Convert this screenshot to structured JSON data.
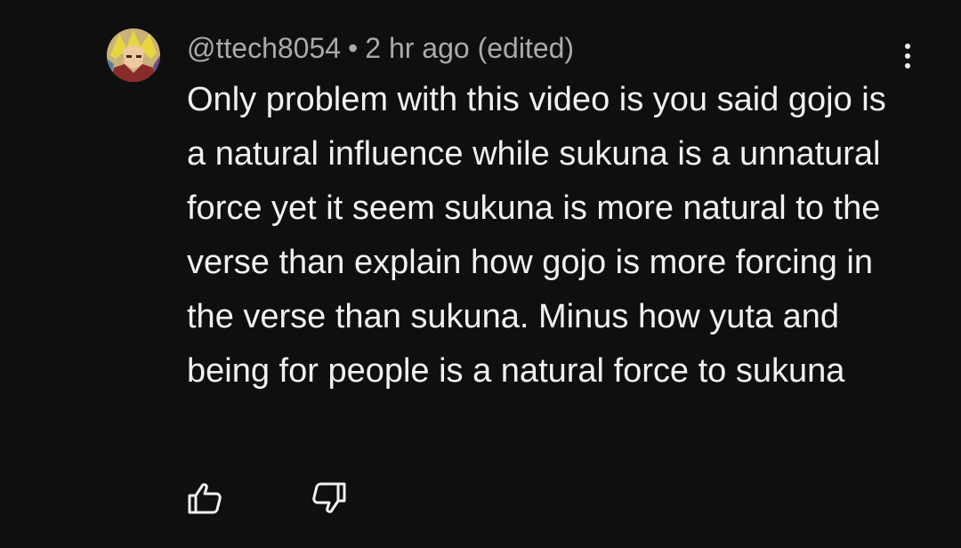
{
  "comment": {
    "author": "@ttech8054",
    "separator": "•",
    "time": "2 hr ago (edited)",
    "text": "Only problem with this video is you said gojo is a natural influence while sukuna is a unnatural force yet it seem sukuna is more natural to the verse than explain how gojo is more forcing in the verse than sukuna. Minus how yuta and being for people is a natural force to sukuna"
  },
  "icons": {
    "avatar": "user-avatar",
    "more": "vertical-ellipsis-icon",
    "like": "thumbs-up-icon",
    "dislike": "thumbs-down-icon"
  },
  "colors": {
    "background": "#0f0f0f",
    "text": "#f1f1f1",
    "meta": "#aaaaaa"
  }
}
